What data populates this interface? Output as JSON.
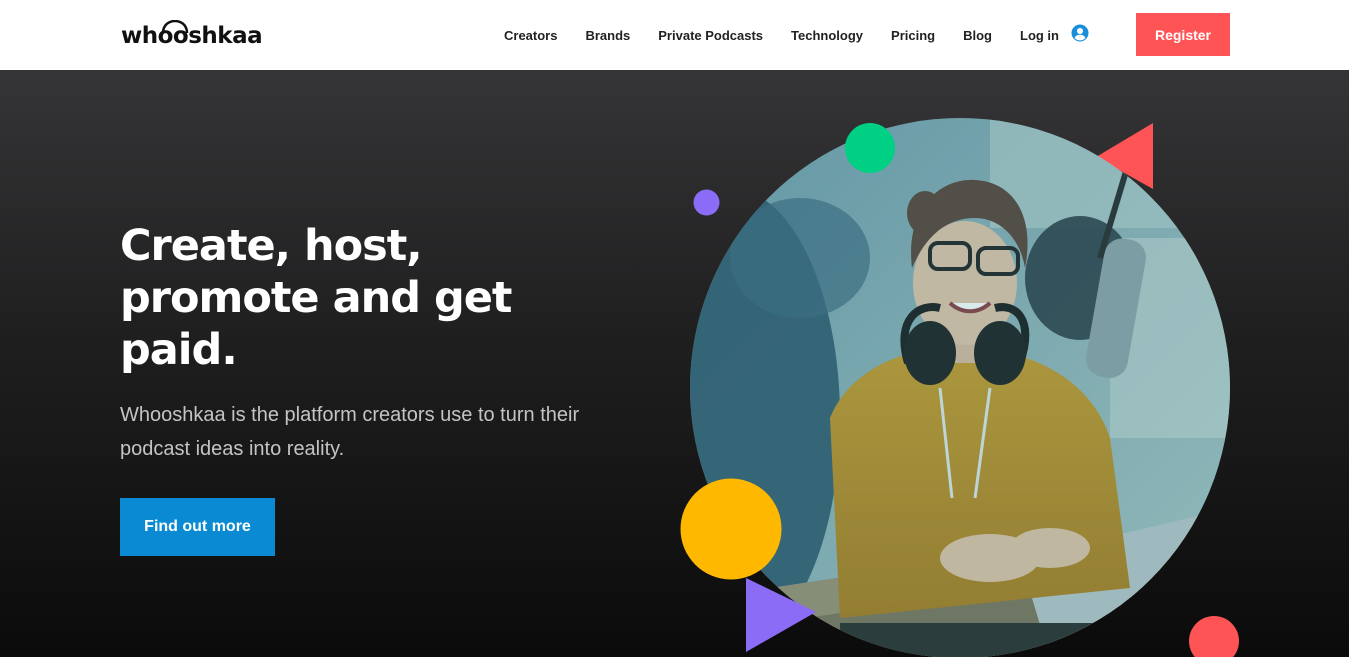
{
  "header": {
    "logo_text": "whooshkaa",
    "nav": [
      {
        "label": "Creators"
      },
      {
        "label": "Brands"
      },
      {
        "label": "Private Podcasts"
      },
      {
        "label": "Technology"
      },
      {
        "label": "Pricing"
      },
      {
        "label": "Blog"
      }
    ],
    "login_label": "Log in",
    "register_label": "Register"
  },
  "hero": {
    "headline": "Create, host, promote and get paid.",
    "subtext": "Whooshkaa is the platform creators use to turn their podcast ideas into reality.",
    "cta_label": "Find out more"
  },
  "colors": {
    "brand_red": "#ff5455",
    "cta_blue": "#0a8ad2",
    "green": "#00d084",
    "purple": "#8b6cf6",
    "yellow": "#ffb800",
    "user_icon_blue": "#1a8fd8"
  },
  "icons": {
    "user": "user-circle-icon",
    "logo_headphones": "headphones-icon"
  }
}
